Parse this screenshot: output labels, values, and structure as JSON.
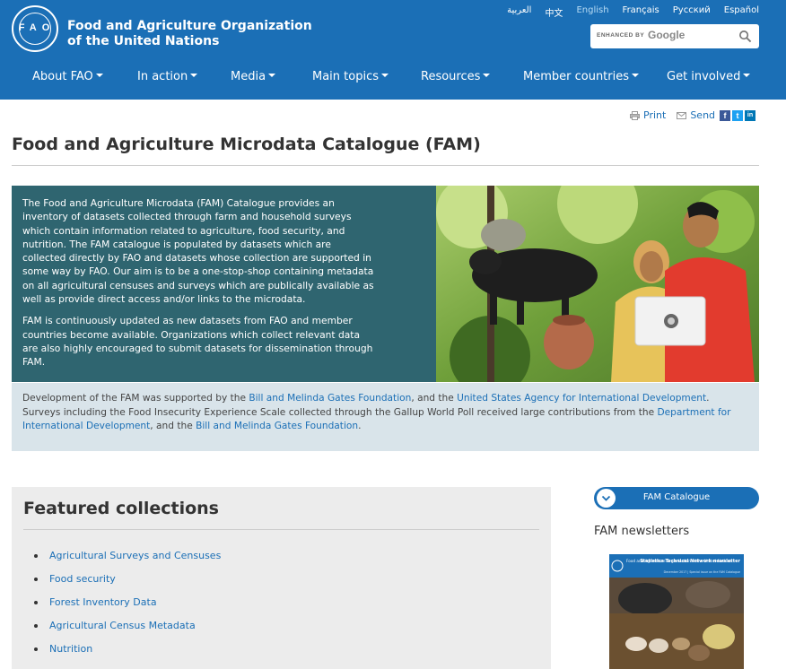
{
  "header": {
    "org_line1": "Food and Agriculture Organization",
    "org_line2": "of the United Nations",
    "logo_text": "FAO",
    "languages": [
      {
        "label": "العربية",
        "active": false
      },
      {
        "label": "中文",
        "active": false
      },
      {
        "label": "English",
        "active": true
      },
      {
        "label": "Français",
        "active": false
      },
      {
        "label": "Русский",
        "active": false
      },
      {
        "label": "Español",
        "active": false
      }
    ],
    "search": {
      "enhanced_label": "ENHANCED BY",
      "google_label": "Google",
      "icon": "search-icon"
    },
    "nav": [
      "About FAO",
      "In action",
      "Media",
      "Main topics",
      "Resources",
      "Member countries",
      "Get involved"
    ]
  },
  "tools": {
    "print_label": "Print",
    "send_label": "Send",
    "social": [
      "f",
      "t",
      "in"
    ]
  },
  "page_title": "Food and Agriculture Microdata Catalogue (FAM)",
  "hero": {
    "paragraph1": "The Food and Agriculture Microdata (FAM) Catalogue provides an inventory of datasets collected through farm and household surveys which contain information related to agriculture, food security,  and nutrition. The FAM catalogue is populated by datasets which are collected directly by FAO and datasets whose collection are supported in some way by FAO. Our aim is to be a one-stop-shop containing metadata on all agricultural censuses and surveys which are publically available as well as provide direct access and/or links to the microdata.",
    "paragraph2": "FAM is continuously updated as new datasets from FAO and member countries become available. Organizations which collect relevant data are also highly encouraged to submit datasets for dissemination through FAM."
  },
  "info": {
    "t1": "Development of the FAM was supported by the ",
    "l1": "Bill and Melinda Gates Foundation",
    "t2": ", and the ",
    "l2": "United States Agency for International Development",
    "t3": ". Surveys including the Food Insecurity Experience Scale collected through the Gallup World Poll received large contributions from the ",
    "l3": "Department for International Development",
    "t4": ", and the ",
    "l4": "Bill and Melinda Gates Foundation",
    "t5": "."
  },
  "featured": {
    "title": "Featured collections",
    "items": [
      "Agricultural Surveys and Censuses",
      "Food security",
      "Forest Inventory Data",
      "Agricultural Census Metadata",
      "Nutrition"
    ]
  },
  "sidebar": {
    "catalogue_button": "FAM Catalogue",
    "newsletters_title": "FAM newsletters",
    "newsletter_header": "Food and Agriculture Organization of the United Nations",
    "newsletter_title": "Statistics Technical Network newsletter",
    "newsletter_sub": "December 2017 | Special issue on the FAM Catalogue"
  },
  "colors": {
    "brand_blue": "#1b6fb6",
    "hero_teal": "#2f6570",
    "info_bg": "#d9e4ea"
  }
}
